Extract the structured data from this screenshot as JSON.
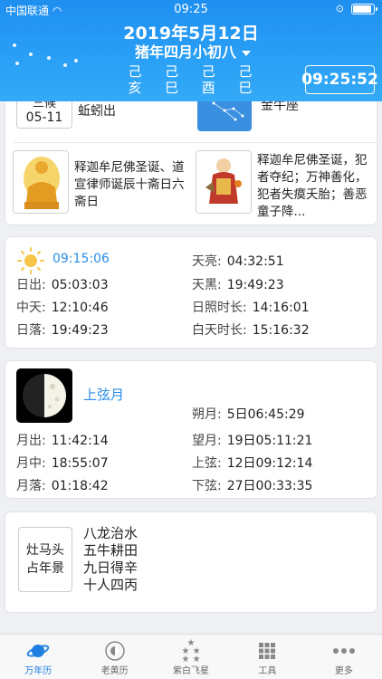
{
  "status_bar": {
    "carrier": "中国联通",
    "time": "09:25"
  },
  "header": {
    "solar_date": "2019年5月12日",
    "lunar_date": "猪年四月小初八",
    "ganzhi": [
      {
        "top": "己",
        "bottom": "亥"
      },
      {
        "top": "己",
        "bottom": "巳"
      },
      {
        "top": "己",
        "bottom": "酉"
      },
      {
        "top": "己",
        "bottom": "巳"
      }
    ],
    "clock": "09:25:52"
  },
  "solar_term": {
    "label": "三候",
    "date": "05-11",
    "description": "蚯蚓出"
  },
  "constellation": {
    "name": "金牛座"
  },
  "festivals": [
    {
      "icon": "buddha-icon",
      "text": "释迦牟尼佛圣诞、道宣律师诞辰十斋日六斋日"
    },
    {
      "icon": "sage-icon",
      "text": "释迦牟尼佛圣诞，犯者夺纪；万神善化，犯者失瘼夭胎；善恶童子降..."
    }
  ],
  "sun": {
    "current": "09:15:06",
    "rise_label": "日出:",
    "rise": "05:03:03",
    "noon_label": "中天:",
    "noon": "12:10:46",
    "set_label": "日落:",
    "set": "19:49:23",
    "dawn_label": "天亮:",
    "dawn": "04:32:51",
    "dusk_label": "天黑:",
    "dusk": "19:49:23",
    "sunshine_label": "日照时长:",
    "sunshine": "14:16:01",
    "daylight_label": "白天时长:",
    "daylight": "15:16:32"
  },
  "moon": {
    "phase": "上弦月",
    "rise_label": "月出:",
    "rise": "11:42:14",
    "mid_label": "月中:",
    "mid": "18:55:07",
    "set_label": "月落:",
    "set": "01:18:42",
    "new_label": "朔月:",
    "new": "5日06:45:29",
    "full_label": "望月:",
    "full": "19日05:11:21",
    "first_q_label": "上弦:",
    "first_q": "12日09:12:14",
    "last_q_label": "下弦:",
    "last_q": "27日00:33:35"
  },
  "almanac": {
    "box_line1": "灶马头",
    "box_line2": "占年景",
    "lines": [
      "八龙治水",
      "五牛耕田",
      "九日得辛",
      "十人四丙"
    ]
  },
  "tabbar": [
    {
      "label": "万年历",
      "icon": "planet-icon",
      "active": true
    },
    {
      "label": "老黄历",
      "icon": "bagua-icon",
      "active": false
    },
    {
      "label": "紫白飞星",
      "icon": "stars-icon",
      "active": false
    },
    {
      "label": "工具",
      "icon": "grid-icon",
      "active": false
    },
    {
      "label": "更多",
      "icon": "more-icon",
      "active": false
    }
  ],
  "colors": {
    "header": "#2196f3",
    "accent": "#2a8de6"
  }
}
